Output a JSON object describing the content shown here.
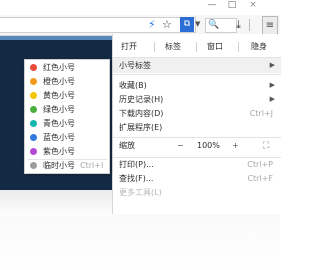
{
  "window": {
    "minimize": "—",
    "maximize": "□",
    "close": "×"
  },
  "toolbar": {
    "lightning_glyph": "⚡",
    "star_glyph": "☆",
    "extension_glyph": "⧉",
    "search_placeholder": "🔍",
    "download_glyph": "⤓",
    "menu_glyph": "≡"
  },
  "menu": {
    "top_buttons": [
      "打开",
      "标签",
      "窗口",
      "隐身"
    ],
    "small_account": {
      "label": "小号标签"
    },
    "items": [
      {
        "label": "收藏(B)",
        "shortcut": "",
        "arrow": true
      },
      {
        "label": "历史记录(H)",
        "shortcut": "",
        "arrow": true
      },
      {
        "label": "下载内容(D)",
        "shortcut": "Ctrl+J",
        "arrow": false
      },
      {
        "label": "扩展程序(E)",
        "shortcut": "",
        "arrow": false
      }
    ],
    "zoom": {
      "label": "缩放",
      "minus": "−",
      "value": "100%",
      "plus": "+",
      "fullscreen": "⛶"
    },
    "bottom_items": [
      {
        "label": "打印(P)...",
        "shortcut": "Ctrl+P"
      },
      {
        "label": "查找(F)...",
        "shortcut": "Ctrl+F"
      },
      {
        "label": "更多工具(L)",
        "shortcut": ""
      }
    ]
  },
  "submenu": {
    "items": [
      {
        "label": "红色小号",
        "color": "#e84a3c"
      },
      {
        "label": "橙色小号",
        "color": "#f39a1c"
      },
      {
        "label": "黄色小号",
        "color": "#f5c400"
      },
      {
        "label": "绿色小号",
        "color": "#4caf3c"
      },
      {
        "label": "青色小号",
        "color": "#16b6b0"
      },
      {
        "label": "蓝色小号",
        "color": "#2f7be0"
      },
      {
        "label": "紫色小号",
        "color": "#b24ad6"
      }
    ],
    "temp": {
      "label": "临时小号",
      "shortcut": "Ctrl+I",
      "color": "#9c9c9c"
    }
  },
  "colors": {
    "page_background": "#142a44",
    "highlight": "#f0f0f0",
    "accent": "#2b6ed6"
  }
}
